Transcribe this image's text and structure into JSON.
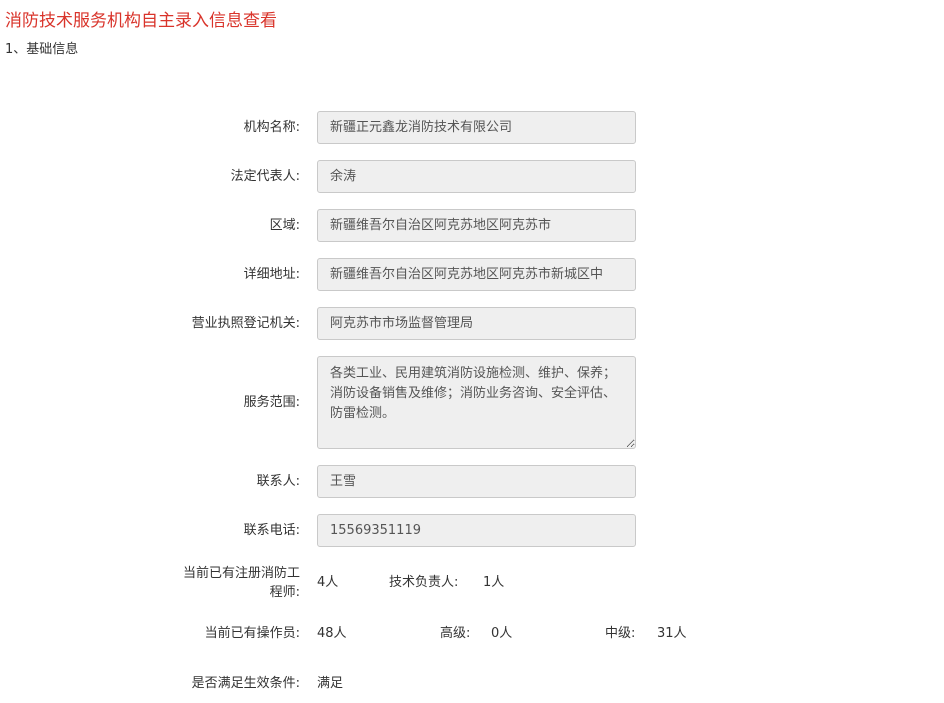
{
  "page_title": "消防技术服务机构自主录入信息查看",
  "section_title": "1、基础信息",
  "fields": {
    "org_name": {
      "label": "机构名称:",
      "value": "新疆正元鑫龙消防技术有限公司"
    },
    "legal_rep": {
      "label": "法定代表人:",
      "value": "余涛"
    },
    "region": {
      "label": "区域:",
      "value": "新疆维吾尔自治区阿克苏地区阿克苏市"
    },
    "address": {
      "label": "详细地址:",
      "value": "新疆维吾尔自治区阿克苏地区阿克苏市新城区中"
    },
    "license_authority": {
      "label": "营业执照登记机关:",
      "value": "阿克苏市市场监督管理局"
    },
    "service_scope": {
      "label": "服务范围:",
      "value": "各类工业、民用建筑消防设施检测、维护、保养；消防设备销售及维修；消防业务咨询、安全评估、防雷检测。"
    },
    "contact": {
      "label": "联系人:",
      "value": "王雪"
    },
    "phone": {
      "label": "联系电话:",
      "value": "15569351119"
    }
  },
  "engineers": {
    "label_line1": "当前已有注册消防工",
    "label_line2": "程师:",
    "count": "4人",
    "tech_lead_label": "技术负责人:",
    "tech_lead_count": "1人"
  },
  "operators": {
    "label": "当前已有操作员:",
    "count": "48人",
    "senior_label": "高级:",
    "senior_count": "0人",
    "middle_label": "中级:",
    "middle_count": "31人"
  },
  "effective": {
    "label": "是否满足生效条件:",
    "value": "满足"
  }
}
